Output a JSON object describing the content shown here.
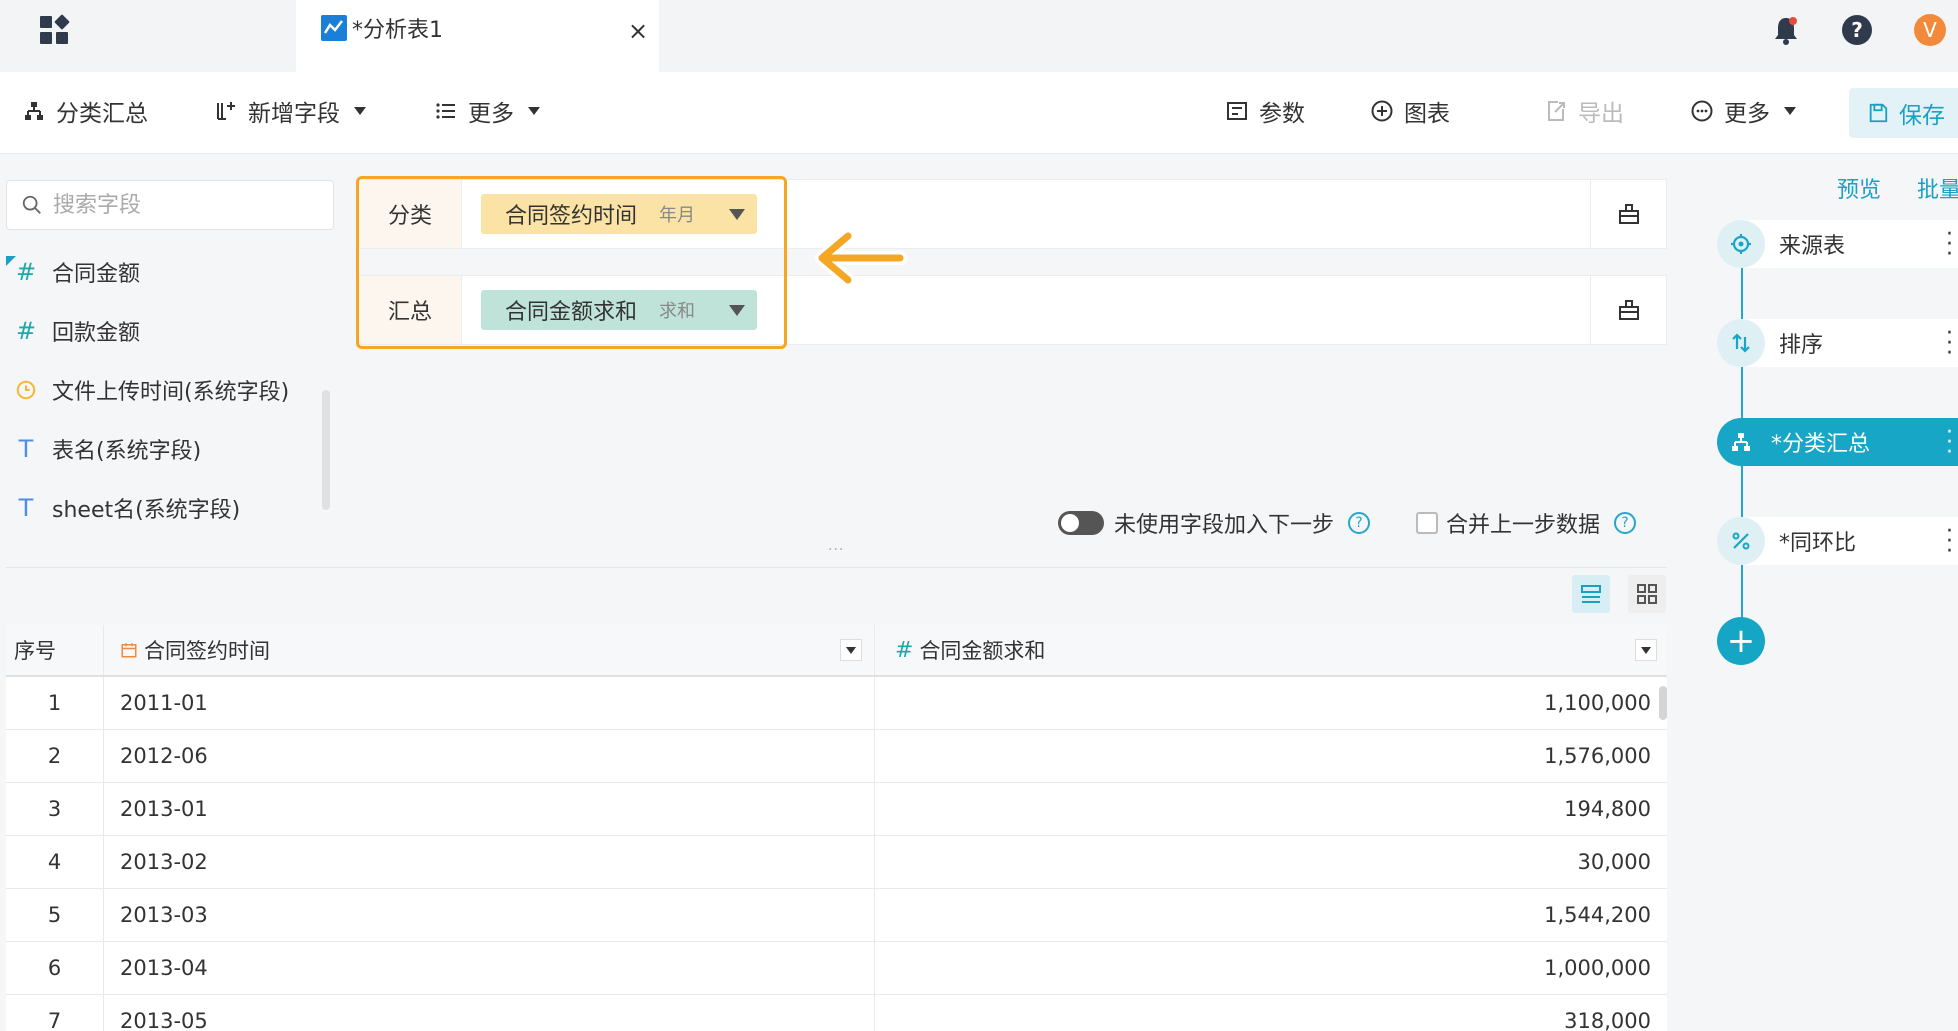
{
  "tab": {
    "title": "*分析表1",
    "close": "×"
  },
  "user": {
    "avatar_initial": "V"
  },
  "toolbar": {
    "group_summary": "分类汇总",
    "add_field": "新增字段",
    "more_left": "更多",
    "params": "参数",
    "chart": "图表",
    "export": "导出",
    "more_right": "更多",
    "save": "保存"
  },
  "left_panel": {
    "search_placeholder": "搜索字段",
    "fields": [
      {
        "icon": "#",
        "label": "合同金额"
      },
      {
        "icon": "#",
        "label": "回款金额"
      },
      {
        "icon": "clock",
        "label": "文件上传时间(系统字段)"
      },
      {
        "icon": "T",
        "label": "表名(系统字段)"
      },
      {
        "icon": "T",
        "label": "sheet名(系统字段)"
      }
    ]
  },
  "config": {
    "group_label": "分类",
    "group_field": "合同签约时间",
    "group_agg": "年月",
    "summary_label": "汇总",
    "summary_field": "合同金额求和",
    "summary_agg": "求和",
    "toggle_label": "未使用字段加入下一步",
    "merge_label": "合并上一步数据",
    "help": "?"
  },
  "table": {
    "headers": [
      "序号",
      "合同签约时间",
      "合同金额求和"
    ],
    "rows": [
      [
        "1",
        "2011-01",
        "1,100,000"
      ],
      [
        "2",
        "2012-06",
        "1,576,000"
      ],
      [
        "3",
        "2013-01",
        "194,800"
      ],
      [
        "4",
        "2013-02",
        "30,000"
      ],
      [
        "5",
        "2013-03",
        "1,544,200"
      ],
      [
        "6",
        "2013-04",
        "1,000,000"
      ],
      [
        "7",
        "2013-05",
        "318,000"
      ]
    ]
  },
  "pipeline": {
    "preview": "预览",
    "batch": "批量",
    "steps": [
      {
        "label": "来源表"
      },
      {
        "label": "排序"
      },
      {
        "label": "*分类汇总"
      },
      {
        "label": "*同环比"
      }
    ],
    "add": "+"
  },
  "colors": {
    "accent": "#18a6c6",
    "highlight": "#f5a623",
    "group_pill": "#fbe3a6",
    "summary_pill": "#bfe3d8"
  }
}
